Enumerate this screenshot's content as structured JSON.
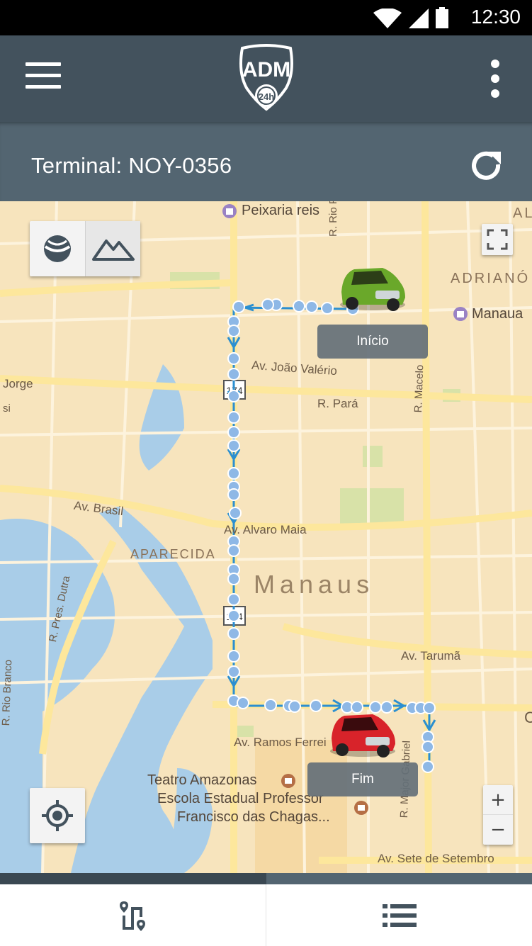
{
  "status_bar": {
    "time": "12:30"
  },
  "app_bar": {
    "logo_text": "ADM",
    "logo_badge": "24h"
  },
  "terminal": {
    "label": "Terminal: NOY-0356"
  },
  "map": {
    "streets": {
      "peixaria": "Peixaria reis",
      "rio_purus": "R. Rio Purus",
      "adriano": "ADRIANÓ",
      "manaura": "Manaua",
      "joao_valerio": "Av. João Valério",
      "para": "R. Pará",
      "macelo": "R. Macelo",
      "jorge": "Jorge",
      "si": "si",
      "brasil": "Av. Brasil",
      "alvaro_maia": "Av. Alvaro Maia",
      "aparecida": "APARECIDA",
      "manaus": "Manaus",
      "pres_dutra": "R. Pres. Dutra",
      "rio_branco": "R. Rio Branco",
      "taruma": "Av. Tarumã",
      "ramos_ferreira": "Av. Ramos Ferrei",
      "major_gabriel": "R. Major Gabriel",
      "teatro": "Teatro Amazonas",
      "escola_1": "Escola Estadual Professor",
      "escola_2": "Francisco das Chagas...",
      "sete_setembro": "Av. Sete de Setembro",
      "al": "AL",
      "route_shield_1": "174",
      "route_shield_2": "174",
      "c_edge": "C"
    },
    "start_label": "Início",
    "end_label": "Fim",
    "zoom_in": "+",
    "zoom_out": "−",
    "colors": {
      "route": "#2b8fd0",
      "point_fill": "#8eb8e6",
      "start_car": "#6aa82a",
      "end_car": "#d8232a"
    }
  },
  "bottom_nav": {
    "progress_fraction": 0.5,
    "tabs": [
      "route-icon",
      "list-icon"
    ]
  }
}
